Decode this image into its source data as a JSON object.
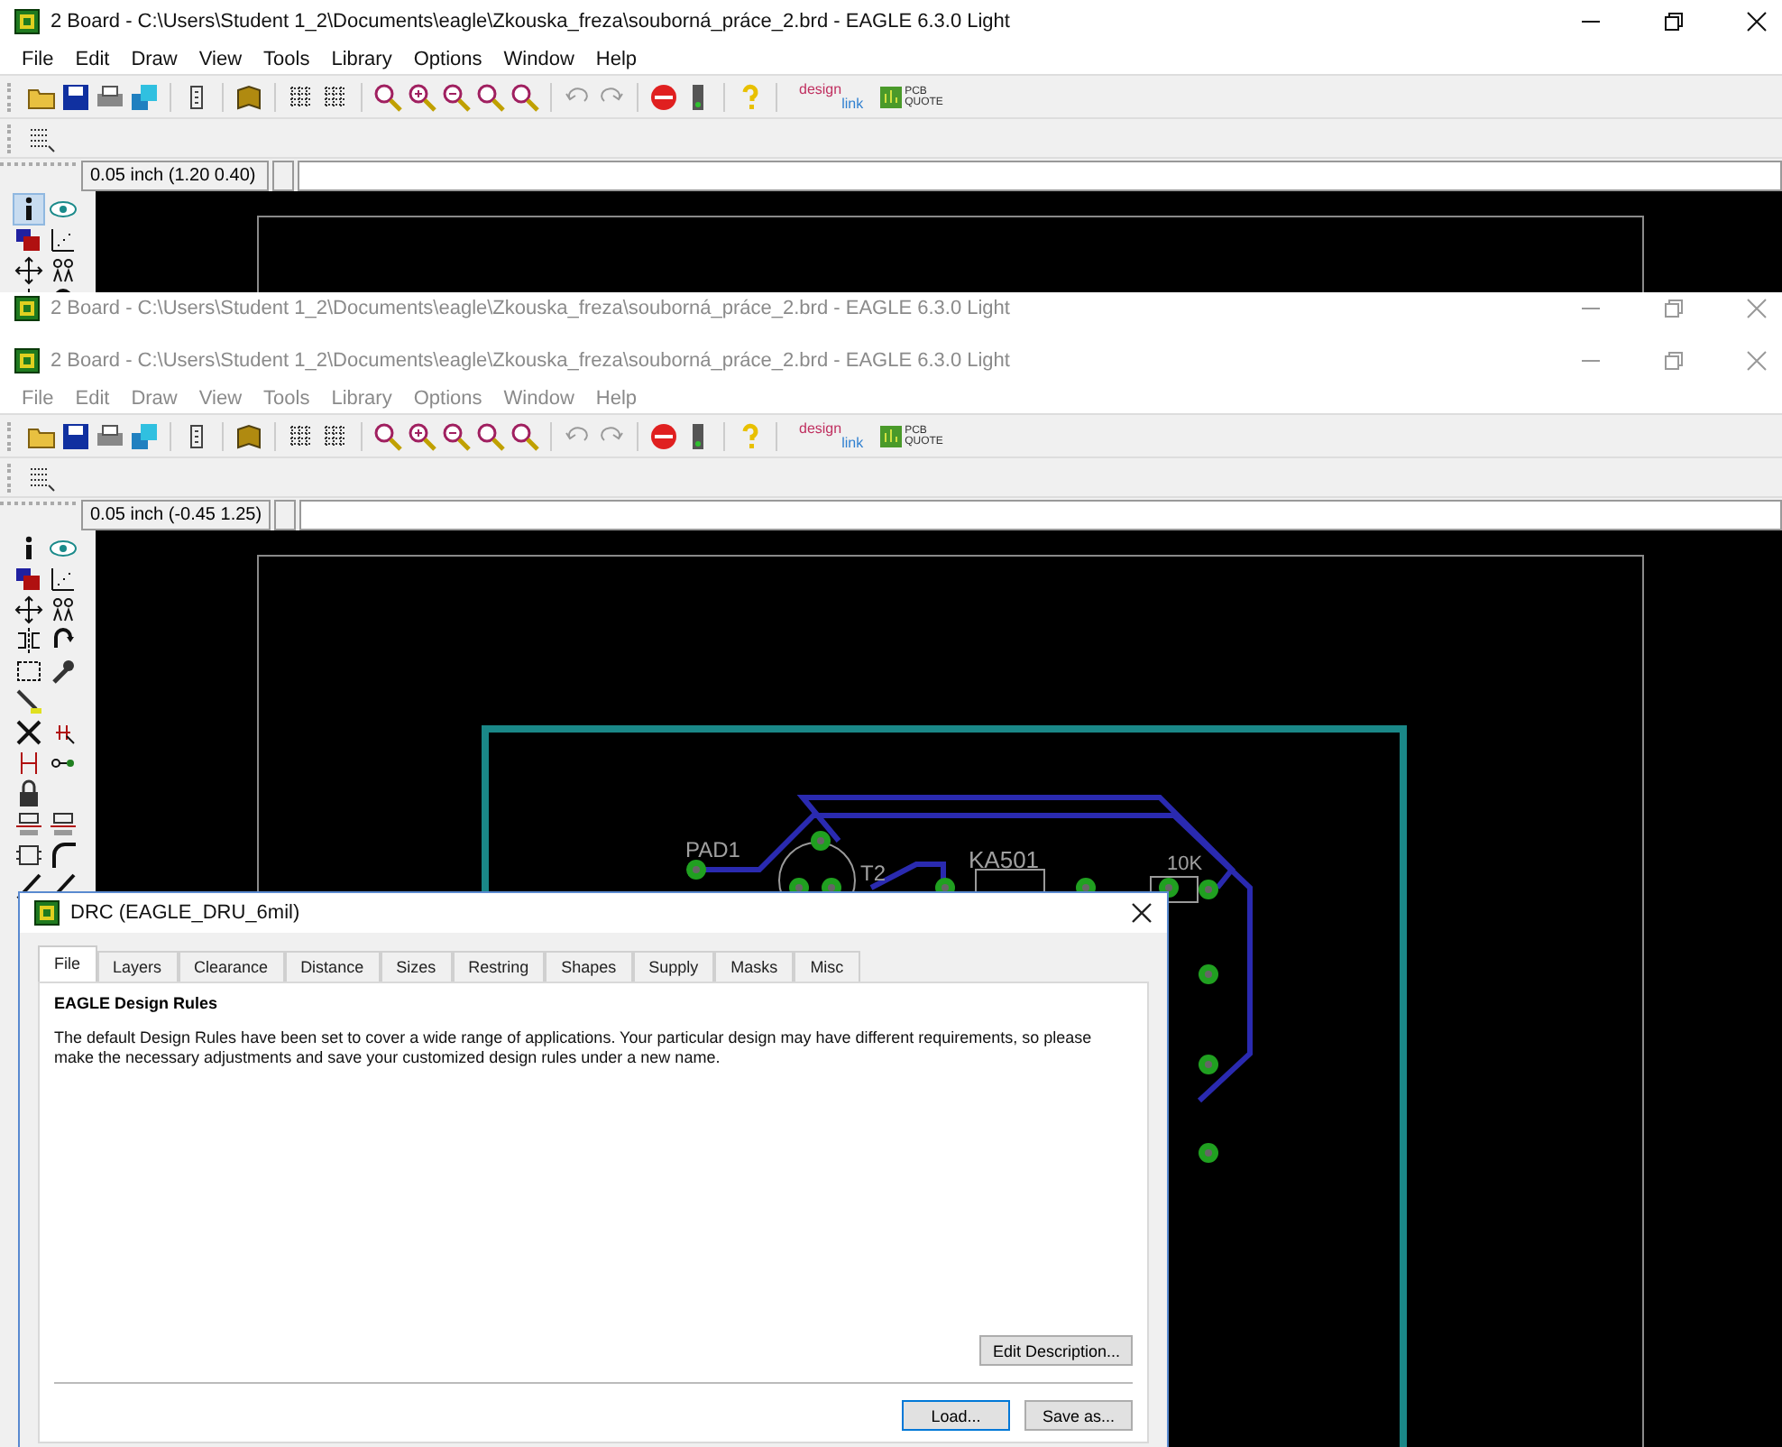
{
  "windows": [
    {
      "kind": "full",
      "active": true,
      "title": "2 Board - C:\\Users\\Student 1_2\\Documents\\eagle\\Zkouska_freza\\souborná_práce_2.brd - EAGLE 6.3.0 Light",
      "menu": [
        "File",
        "Edit",
        "Draw",
        "View",
        "Tools",
        "Library",
        "Options",
        "Window",
        "Help"
      ],
      "logos": [
        "design",
        "link",
        "PCB",
        "QUOTE"
      ],
      "coordinates": "0.05 inch (1.20 0.40)"
    },
    {
      "kind": "title_only",
      "active": false,
      "title": "2 Board - C:\\Users\\Student 1_2\\Documents\\eagle\\Zkouska_freza\\souborná_práce_2.brd - EAGLE 6.3.0 Light"
    },
    {
      "kind": "full",
      "active": false,
      "title": "2 Board - C:\\Users\\Student 1_2\\Documents\\eagle\\Zkouska_freza\\souborná_práce_2.brd - EAGLE 6.3.0 Light",
      "menu": [
        "File",
        "Edit",
        "Draw",
        "View",
        "Tools",
        "Library",
        "Options",
        "Window",
        "Help"
      ],
      "logos": [
        "design",
        "link",
        "PCB",
        "QUOTE"
      ],
      "coordinates": "0.05 inch (-0.45 1.25)",
      "board": {
        "labels": [
          "PAD1",
          "T2",
          "KA501",
          "10K"
        ]
      },
      "dialog": {
        "title": "DRC (EAGLE_DRU_6mil)",
        "tabs": [
          {
            "label": "File",
            "selected": true
          },
          {
            "label": "Layers",
            "selected": false
          },
          {
            "label": "Clearance",
            "selected": false
          },
          {
            "label": "Distance",
            "selected": false
          },
          {
            "label": "Sizes",
            "selected": false
          },
          {
            "label": "Restring",
            "selected": false
          },
          {
            "label": "Shapes",
            "selected": false
          },
          {
            "label": "Supply",
            "selected": false
          },
          {
            "label": "Masks",
            "selected": false
          },
          {
            "label": "Misc",
            "selected": false
          }
        ],
        "heading": "EAGLE Design Rules",
        "text": "The default Design Rules have been set to cover a wide range of applications. Your particular design may have different requirements, so please make the necessary adjustments and save your customized design rules under a new name.",
        "edit_button": "Edit Description...",
        "buttons": [
          "Load...",
          "Save as..."
        ]
      }
    }
  ]
}
